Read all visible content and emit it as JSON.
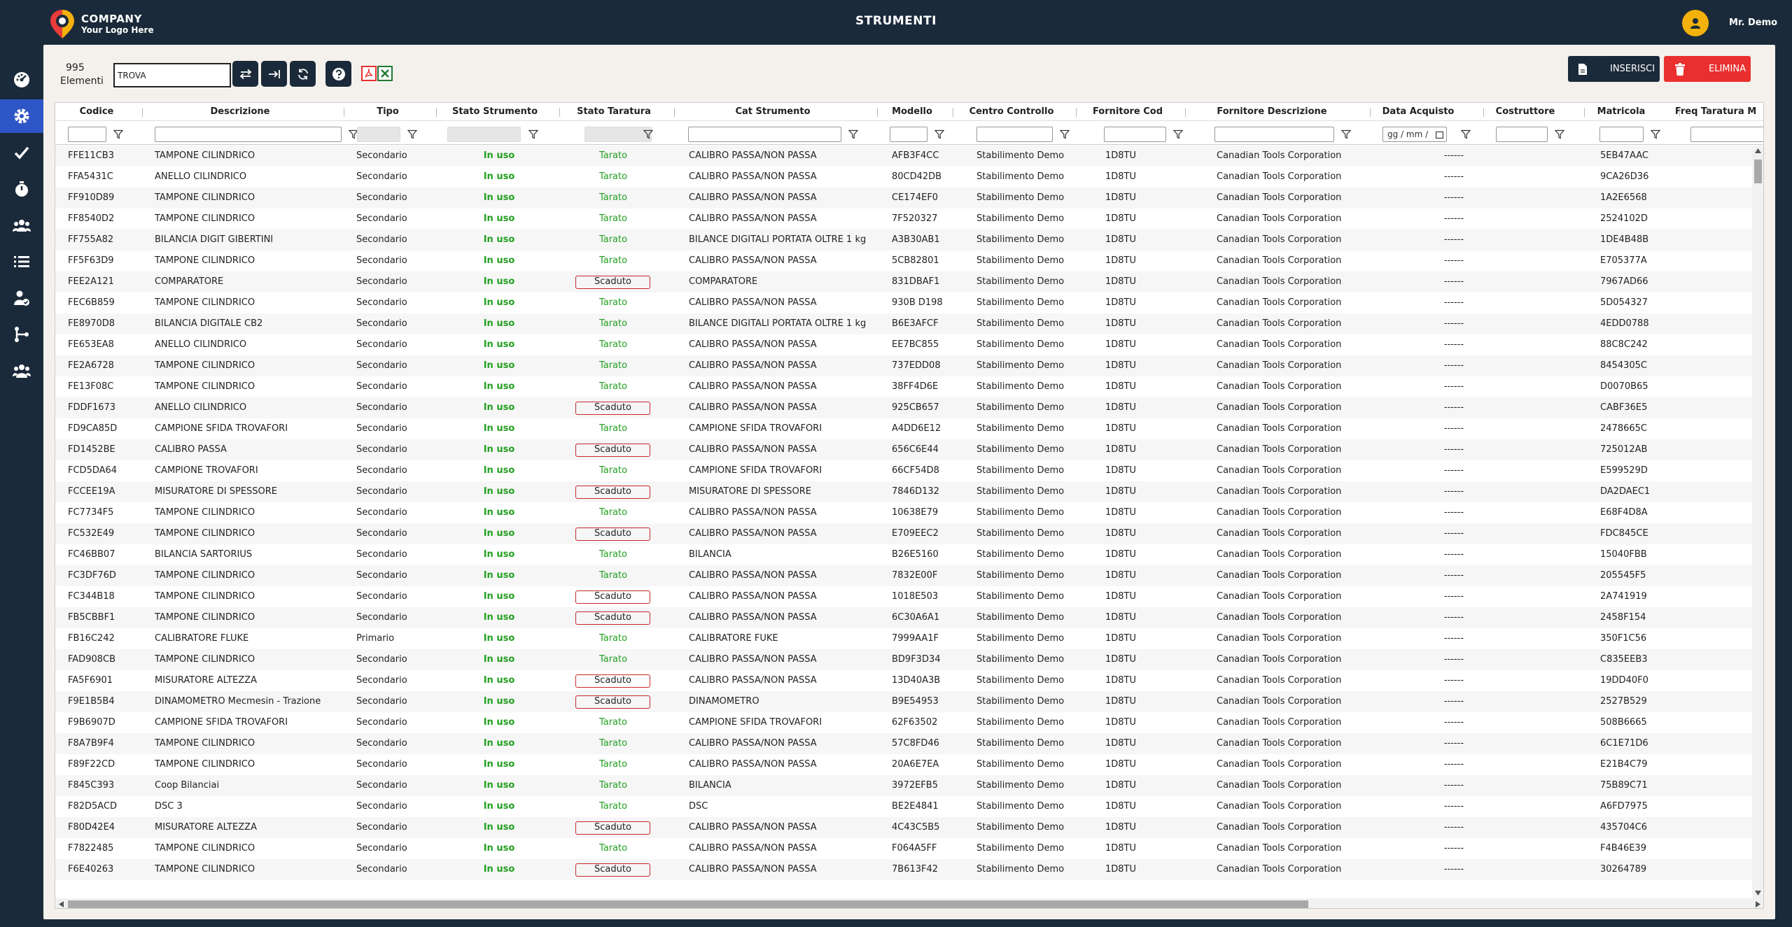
{
  "header": {
    "company": "COMPANY",
    "tagline": "Your Logo Here",
    "title": "STRUMENTI",
    "user": "Mr. Demo"
  },
  "sidebar": {
    "items": [
      {
        "icon": "dashboard-icon"
      },
      {
        "icon": "gear-icon"
      },
      {
        "icon": "check-icon"
      },
      {
        "icon": "stopwatch-icon"
      },
      {
        "icon": "group-icon"
      },
      {
        "icon": "list-icon"
      },
      {
        "icon": "user-check-icon"
      },
      {
        "icon": "branch-icon"
      },
      {
        "icon": "users-icon"
      }
    ]
  },
  "toolbar": {
    "count": "995",
    "count_label": "Elementi",
    "search_value": "TROVA",
    "insert_label": "INSERISCI",
    "delete_label": "ELIMINA",
    "date_placeholder": "gg / mm /"
  },
  "columns": [
    "Codice",
    "Descrizione",
    "Tipo",
    "Stato Strumento",
    "Stato Taratura",
    "Cat Strumento",
    "Modello",
    "Centro Controllo",
    "Fornitore Cod",
    "Fornitore Descrizione",
    "Data Acquisto",
    "Costruttore",
    "Matricola",
    "Freq Taratura M"
  ],
  "rows": [
    [
      "FFE11CB3",
      "TAMPONE CILINDRICO",
      "Secondario",
      "In uso",
      "Tarato",
      "CALIBRO PASSA/NON PASSA",
      "AFB3F4CC",
      "Stabilimento Demo",
      "1D8TU",
      "Canadian Tools Corporation",
      "------",
      "",
      "5EB47AAC"
    ],
    [
      "FFA5431C",
      "ANELLO CILINDRICO",
      "Secondario",
      "In uso",
      "Tarato",
      "CALIBRO PASSA/NON PASSA",
      "80CD42DB",
      "Stabilimento Demo",
      "1D8TU",
      "Canadian Tools Corporation",
      "------",
      "",
      "9CA26D36"
    ],
    [
      "FF910D89",
      "TAMPONE CILINDRICO",
      "Secondario",
      "In uso",
      "Tarato",
      "CALIBRO PASSA/NON PASSA",
      "CE174EF0",
      "Stabilimento Demo",
      "1D8TU",
      "Canadian Tools Corporation",
      "------",
      "",
      "1A2E6568"
    ],
    [
      "FF8540D2",
      "TAMPONE CILINDRICO",
      "Secondario",
      "In uso",
      "Tarato",
      "CALIBRO PASSA/NON PASSA",
      "7F520327",
      "Stabilimento Demo",
      "1D8TU",
      "Canadian Tools Corporation",
      "------",
      "",
      "2524102D"
    ],
    [
      "FF755A82",
      "BILANCIA DIGIT GIBERTINI",
      "Secondario",
      "In uso",
      "Tarato",
      "BILANCE DIGITALI PORTATA OLTRE 1 kg",
      "A3B30AB1",
      "Stabilimento Demo",
      "1D8TU",
      "Canadian Tools Corporation",
      "------",
      "",
      "1DE4B48B"
    ],
    [
      "FF5F63D9",
      "TAMPONE CILINDRICO",
      "Secondario",
      "In uso",
      "Tarato",
      "CALIBRO PASSA/NON PASSA",
      "5CB82801",
      "Stabilimento Demo",
      "1D8TU",
      "Canadian Tools Corporation",
      "------",
      "",
      "E705377A"
    ],
    [
      "FEE2A121",
      "COMPARATORE",
      "Secondario",
      "In uso",
      "Scaduto",
      "COMPARATORE",
      "831DBAF1",
      "Stabilimento Demo",
      "1D8TU",
      "Canadian Tools Corporation",
      "------",
      "",
      "7967AD66"
    ],
    [
      "FEC6B859",
      "TAMPONE CILINDRICO",
      "Secondario",
      "In uso",
      "Tarato",
      "CALIBRO PASSA/NON PASSA",
      "930B D198",
      "Stabilimento Demo",
      "1D8TU",
      "Canadian Tools Corporation",
      "------",
      "",
      "5D054327"
    ],
    [
      "FE8970D8",
      "BILANCIA DIGITALE CB2",
      "Secondario",
      "In uso",
      "Tarato",
      "BILANCE DIGITALI PORTATA OLTRE 1 kg",
      "B6E3AFCF",
      "Stabilimento Demo",
      "1D8TU",
      "Canadian Tools Corporation",
      "------",
      "",
      "4EDD0788"
    ],
    [
      "FE653EA8",
      "ANELLO CILINDRICO",
      "Secondario",
      "In uso",
      "Tarato",
      "CALIBRO PASSA/NON PASSA",
      "EE7BC855",
      "Stabilimento Demo",
      "1D8TU",
      "Canadian Tools Corporation",
      "------",
      "",
      "88C8C242"
    ],
    [
      "FE2A6728",
      "TAMPONE CILINDRICO",
      "Secondario",
      "In uso",
      "Tarato",
      "CALIBRO PASSA/NON PASSA",
      "737EDD08",
      "Stabilimento Demo",
      "1D8TU",
      "Canadian Tools Corporation",
      "------",
      "",
      "8454305C"
    ],
    [
      "FE13F08C",
      "TAMPONE CILINDRICO",
      "Secondario",
      "In uso",
      "Tarato",
      "CALIBRO PASSA/NON PASSA",
      "38FF4D6E",
      "Stabilimento Demo",
      "1D8TU",
      "Canadian Tools Corporation",
      "------",
      "",
      "D0070B65"
    ],
    [
      "FDDF1673",
      "ANELLO CILINDRICO",
      "Secondario",
      "In uso",
      "Scaduto",
      "CALIBRO PASSA/NON PASSA",
      "925CB657",
      "Stabilimento Demo",
      "1D8TU",
      "Canadian Tools Corporation",
      "------",
      "",
      "CABF36E5"
    ],
    [
      "FD9CA85D",
      "CAMPIONE SFIDA TROVAFORI",
      "Secondario",
      "In uso",
      "Tarato",
      "CAMPIONE SFIDA TROVAFORI",
      "A4DD6E12",
      "Stabilimento Demo",
      "1D8TU",
      "Canadian Tools Corporation",
      "------",
      "",
      "2478665C"
    ],
    [
      "FD1452BE",
      "CALIBRO PASSA",
      "Secondario",
      "In uso",
      "Scaduto",
      "CALIBRO PASSA/NON PASSA",
      "656C6E44",
      "Stabilimento Demo",
      "1D8TU",
      "Canadian Tools Corporation",
      "------",
      "",
      "725012AB"
    ],
    [
      "FCD5DA64",
      "CAMPIONE TROVAFORI",
      "Secondario",
      "In uso",
      "Tarato",
      "CAMPIONE SFIDA TROVAFORI",
      "66CF54D8",
      "Stabilimento Demo",
      "1D8TU",
      "Canadian Tools Corporation",
      "------",
      "",
      "E599529D"
    ],
    [
      "FCCEE19A",
      "MISURATORE DI SPESSORE",
      "Secondario",
      "In uso",
      "Scaduto",
      "MISURATORE DI SPESSORE",
      "7846D132",
      "Stabilimento Demo",
      "1D8TU",
      "Canadian Tools Corporation",
      "------",
      "",
      "DA2DAEC1"
    ],
    [
      "FC7734F5",
      "TAMPONE CILINDRICO",
      "Secondario",
      "In uso",
      "Tarato",
      "CALIBRO PASSA/NON PASSA",
      "10638E79",
      "Stabilimento Demo",
      "1D8TU",
      "Canadian Tools Corporation",
      "------",
      "",
      "E68F4D8A"
    ],
    [
      "FC532E49",
      "TAMPONE CILINDRICO",
      "Secondario",
      "In uso",
      "Scaduto",
      "CALIBRO PASSA/NON PASSA",
      "E709EEC2",
      "Stabilimento Demo",
      "1D8TU",
      "Canadian Tools Corporation",
      "------",
      "",
      "FDC845CE"
    ],
    [
      "FC46BB07",
      "BILANCIA SARTORIUS",
      "Secondario",
      "In uso",
      "Tarato",
      "BILANCIA",
      "B26E5160",
      "Stabilimento Demo",
      "1D8TU",
      "Canadian Tools Corporation",
      "------",
      "",
      "15040FBB"
    ],
    [
      "FC3DF76D",
      "TAMPONE CILINDRICO",
      "Secondario",
      "In uso",
      "Tarato",
      "CALIBRO PASSA/NON PASSA",
      "7832E00F",
      "Stabilimento Demo",
      "1D8TU",
      "Canadian Tools Corporation",
      "------",
      "",
      "205545F5"
    ],
    [
      "FC344B18",
      "TAMPONE CILINDRICO",
      "Secondario",
      "In uso",
      "Scaduto",
      "CALIBRO PASSA/NON PASSA",
      "1018E503",
      "Stabilimento Demo",
      "1D8TU",
      "Canadian Tools Corporation",
      "------",
      "",
      "2A741919"
    ],
    [
      "FB5CBBF1",
      "TAMPONE CILINDRICO",
      "Secondario",
      "In uso",
      "Scaduto",
      "CALIBRO PASSA/NON PASSA",
      "6C30A6A1",
      "Stabilimento Demo",
      "1D8TU",
      "Canadian Tools Corporation",
      "------",
      "",
      "2458F154"
    ],
    [
      "FB16C242",
      "CALIBRATORE FLUKE",
      "Primario",
      "In uso",
      "Tarato",
      "CALIBRATORE FUKE",
      "7999AA1F",
      "Stabilimento Demo",
      "1D8TU",
      "Canadian Tools Corporation",
      "------",
      "",
      "350F1C56"
    ],
    [
      "FAD908CB",
      "TAMPONE CILINDRICO",
      "Secondario",
      "In uso",
      "Tarato",
      "CALIBRO PASSA/NON PASSA",
      "BD9F3D34",
      "Stabilimento Demo",
      "1D8TU",
      "Canadian Tools Corporation",
      "------",
      "",
      "C835EEB3"
    ],
    [
      "FA5F6901",
      "MISURATORE ALTEZZA",
      "Secondario",
      "In uso",
      "Scaduto",
      "CALIBRO PASSA/NON PASSA",
      "13D40A3B",
      "Stabilimento Demo",
      "1D8TU",
      "Canadian Tools Corporation",
      "------",
      "",
      "19DD40F0"
    ],
    [
      "F9E1B5B4",
      "DINAMOMETRO Mecmesin - Trazione",
      "Secondario",
      "In uso",
      "Scaduto",
      "DINAMOMETRO",
      "B9E54953",
      "Stabilimento Demo",
      "1D8TU",
      "Canadian Tools Corporation",
      "------",
      "",
      "2527B529"
    ],
    [
      "F9B6907D",
      "CAMPIONE SFIDA TROVAFORI",
      "Secondario",
      "In uso",
      "Tarato",
      "CAMPIONE SFIDA TROVAFORI",
      "62F63502",
      "Stabilimento Demo",
      "1D8TU",
      "Canadian Tools Corporation",
      "------",
      "",
      "508B6665"
    ],
    [
      "F8A7B9F4",
      "TAMPONE CILINDRICO",
      "Secondario",
      "In uso",
      "Tarato",
      "CALIBRO PASSA/NON PASSA",
      "57C8FD46",
      "Stabilimento Demo",
      "1D8TU",
      "Canadian Tools Corporation",
      "------",
      "",
      "6C1E71D6"
    ],
    [
      "F89F22CD",
      "TAMPONE CILINDRICO",
      "Secondario",
      "In uso",
      "Tarato",
      "CALIBRO PASSA/NON PASSA",
      "20A6E7EA",
      "Stabilimento Demo",
      "1D8TU",
      "Canadian Tools Corporation",
      "------",
      "",
      "E21B4C79"
    ],
    [
      "F845C393",
      "Coop Bilanciai",
      "Secondario",
      "In uso",
      "Tarato",
      "BILANCIA",
      "3972EFB5",
      "Stabilimento Demo",
      "1D8TU",
      "Canadian Tools Corporation",
      "------",
      "",
      "75B89C71"
    ],
    [
      "F82D5ACD",
      "DSC 3",
      "Secondario",
      "In uso",
      "Tarato",
      "DSC",
      "BE2E4841",
      "Stabilimento Demo",
      "1D8TU",
      "Canadian Tools Corporation",
      "------",
      "",
      "A6FD7975"
    ],
    [
      "F80D42E4",
      "MISURATORE ALTEZZA",
      "Secondario",
      "In uso",
      "Scaduto",
      "CALIBRO PASSA/NON PASSA",
      "4C43C5B5",
      "Stabilimento Demo",
      "1D8TU",
      "Canadian Tools Corporation",
      "------",
      "",
      "435704C6"
    ],
    [
      "F7822485",
      "TAMPONE CILINDRICO",
      "Secondario",
      "In uso",
      "Tarato",
      "CALIBRO PASSA/NON PASSA",
      "F064A5FF",
      "Stabilimento Demo",
      "1D8TU",
      "Canadian Tools Corporation",
      "------",
      "",
      "F4B46E39"
    ],
    [
      "F6E40263",
      "TAMPONE CILINDRICO",
      "Secondario",
      "In uso",
      "Scaduto",
      "CALIBRO PASSA/NON PASSA",
      "7B613F42",
      "Stabilimento Demo",
      "1D8TU",
      "Canadian Tools Corporation",
      "------",
      "",
      "30264789"
    ]
  ],
  "colors": {
    "navy": "#1b2a3a",
    "accent": "#2f56c6",
    "danger": "#e9302f",
    "ok": "#22a020",
    "avatar": "#f2b10b"
  }
}
